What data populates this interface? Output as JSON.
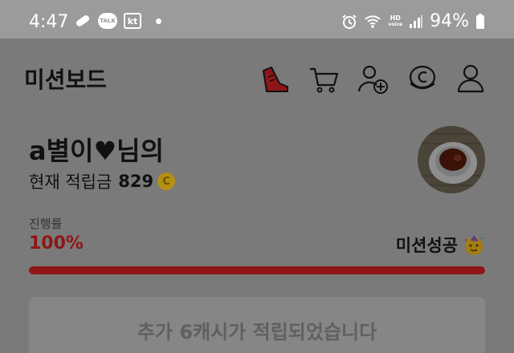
{
  "status_bar": {
    "time": "4:47",
    "talk_label": "TALK",
    "kt_label": "kt",
    "hd_label": "HD",
    "voice_label": "voice",
    "battery": "94%"
  },
  "header": {
    "title": "미션보드",
    "icons": [
      "shoe-icon",
      "cart-icon",
      "add-friend-icon",
      "coin-icon",
      "profile-icon"
    ]
  },
  "user": {
    "name": "a별이♥님의",
    "points_label": "현재 적립금",
    "points_value": "829",
    "coin_symbol": "C"
  },
  "progress": {
    "label": "진행률",
    "percent_text": "100%",
    "value": 1.0,
    "status": "미션성공",
    "bar_color": "#8f1616"
  },
  "banner": {
    "text": "추가 6캐시가 적립되었습니다"
  }
}
